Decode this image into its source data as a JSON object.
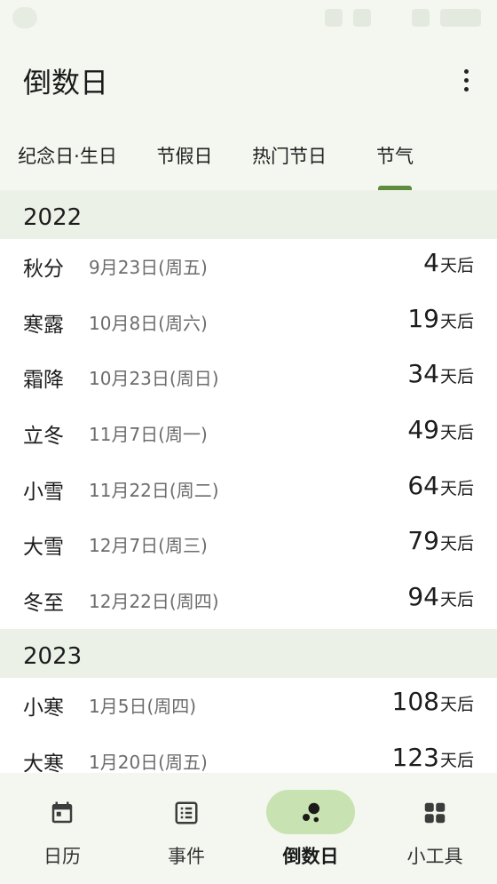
{
  "app": {
    "title": "倒数日"
  },
  "tabs": [
    {
      "label": "纪念日·生日"
    },
    {
      "label": "节假日"
    },
    {
      "label": "热门节日"
    },
    {
      "label": "节气",
      "active": true
    }
  ],
  "sections": [
    {
      "year": "2022",
      "items": [
        {
          "name": "秋分",
          "date": "9月23日(周五)",
          "days": "4",
          "unit": "天后"
        },
        {
          "name": "寒露",
          "date": "10月8日(周六)",
          "days": "19",
          "unit": "天后"
        },
        {
          "name": "霜降",
          "date": "10月23日(周日)",
          "days": "34",
          "unit": "天后"
        },
        {
          "name": "立冬",
          "date": "11月7日(周一)",
          "days": "49",
          "unit": "天后"
        },
        {
          "name": "小雪",
          "date": "11月22日(周二)",
          "days": "64",
          "unit": "天后"
        },
        {
          "name": "大雪",
          "date": "12月7日(周三)",
          "days": "79",
          "unit": "天后"
        },
        {
          "name": "冬至",
          "date": "12月22日(周四)",
          "days": "94",
          "unit": "天后"
        }
      ]
    },
    {
      "year": "2023",
      "items": [
        {
          "name": "小寒",
          "date": "1月5日(周四)",
          "days": "108",
          "unit": "天后"
        },
        {
          "name": "大寒",
          "date": "1月20日(周五)",
          "days": "123",
          "unit": "天后"
        }
      ]
    }
  ],
  "bottom_nav": [
    {
      "label": "日历",
      "icon": "calendar-icon"
    },
    {
      "label": "事件",
      "icon": "list-icon"
    },
    {
      "label": "倒数日",
      "icon": "countdown-icon",
      "active": true
    },
    {
      "label": "小工具",
      "icon": "widgets-icon"
    }
  ],
  "colors": {
    "accent": "#5f8d3d",
    "active_pill": "#c9e2b1",
    "header_bg": "#ecf1e7",
    "page_bg": "#f4f7f0"
  }
}
